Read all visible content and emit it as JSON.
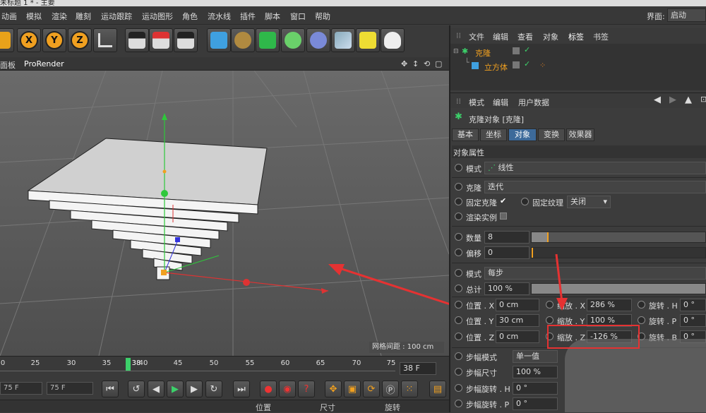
{
  "window": {
    "title": "未标题 1 * - 主要"
  },
  "menu": [
    "动画",
    "模拟",
    "渲染",
    "雕刻",
    "运动跟踪",
    "运动图形",
    "角色",
    "流水线",
    "插件",
    "脚本",
    "窗口",
    "帮助"
  ],
  "interface": {
    "label": "界面:",
    "value": "启动"
  },
  "viewport": {
    "tabs": [
      "面板",
      "ProRender"
    ],
    "grid_label": "网格间距 : 100 cm"
  },
  "timeline": {
    "ticks": [
      "0",
      "25",
      "30",
      "35",
      "38",
      "40",
      "45",
      "50",
      "55",
      "60",
      "65",
      "70",
      "75"
    ],
    "current_frame": "38F",
    "frame_box": "38 F"
  },
  "playback": {
    "start_field": "75 F",
    "end_field": "75 F"
  },
  "bottombar": {
    "position": "位置",
    "size": "尺寸",
    "rotation": "旋转"
  },
  "object_manager": {
    "menu": [
      "文件",
      "编辑",
      "查看",
      "对象",
      "标签",
      "书签"
    ],
    "objects": [
      {
        "name": "克隆"
      },
      {
        "name": "立方体"
      }
    ]
  },
  "attribute_manager": {
    "menu": [
      "模式",
      "编辑",
      "用户数据"
    ],
    "title": "克隆对象 [克隆]",
    "tabs": [
      "基本",
      "坐标",
      "对象",
      "变换",
      "效果器"
    ],
    "active_tab": "对象",
    "section": "对象属性",
    "mode_label": "模式",
    "mode_value": "线性",
    "clone_label": "克隆",
    "clone_value": "迭代",
    "fixed_clone_label": "固定克隆",
    "fixed_clone_check": "✔",
    "fixed_texture_label": "固定纹理",
    "fixed_texture_value": "关闭",
    "render_instance_label": "渲染实例",
    "count_label": "数量",
    "count_value": "8",
    "offset_label": "偏移",
    "offset_value": "0",
    "mode2_label": "模式",
    "mode2_value": "每步",
    "total_label": "总计",
    "total_value": "100 %",
    "pos_x_label": "位置 . X",
    "pos_x": "0 cm",
    "pos_y_label": "位置 . Y",
    "pos_y": "30 cm",
    "pos_z_label": "位置 . Z",
    "pos_z": "0 cm",
    "scale_x_label": "缩放 . X",
    "scale_x": "286 %",
    "scale_y_label": "缩放 . Y",
    "scale_y": "100 %",
    "scale_z_label": "缩放 . Z",
    "scale_z": "-126 %",
    "rot_h_label": "旋转 . H",
    "rot_h": "0 °",
    "rot_p_label": "旋转 . P",
    "rot_p": "0 °",
    "rot_b_label": "旋转 . B",
    "rot_b": "0 °",
    "step_mode_label": "步幅模式",
    "step_mode_value": "单一值",
    "step_size_label": "步幅尺寸",
    "step_size_value": "100 %",
    "step_rot_h_label": "步幅旋转 . H",
    "step_rot_h": "0 °",
    "step_rot_p_label": "步幅旋转 . P",
    "step_rot_p": "0 °"
  },
  "colors": {
    "accent": "#3d6a9a",
    "highlight": "#e53232",
    "orange": "#f0a020"
  }
}
